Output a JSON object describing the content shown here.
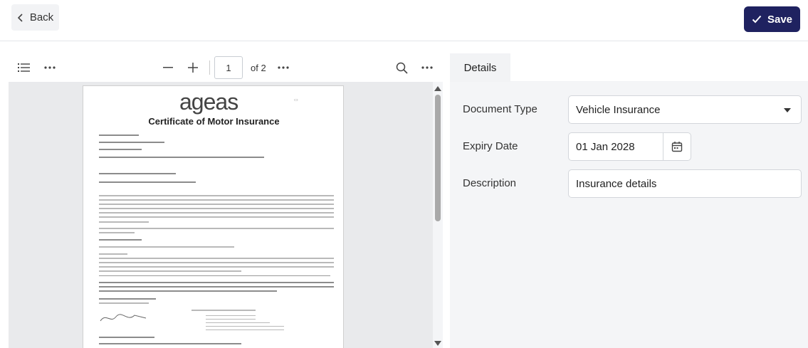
{
  "header": {
    "back_label": "Back",
    "save_label": "Save"
  },
  "viewer": {
    "toolbar": {
      "current_page": "1",
      "page_count_label": "of 2",
      "icons": [
        "list-icon",
        "more-icon",
        "zoom-out-icon",
        "zoom-in-icon",
        "more-icon",
        "search-icon",
        "more-icon"
      ]
    },
    "document": {
      "logo_text": "ageas",
      "title": "Certificate of Motor Insurance"
    }
  },
  "details": {
    "tab_label": "Details",
    "document_type": {
      "label": "Document Type",
      "value": "Vehicle Insurance"
    },
    "expiry_date": {
      "label": "Expiry Date",
      "value": "01 Jan 2028"
    },
    "description": {
      "label": "Description",
      "value": "Insurance details"
    }
  },
  "colors": {
    "save_button": "#1f2260",
    "panel_background": "#f4f5f7"
  }
}
